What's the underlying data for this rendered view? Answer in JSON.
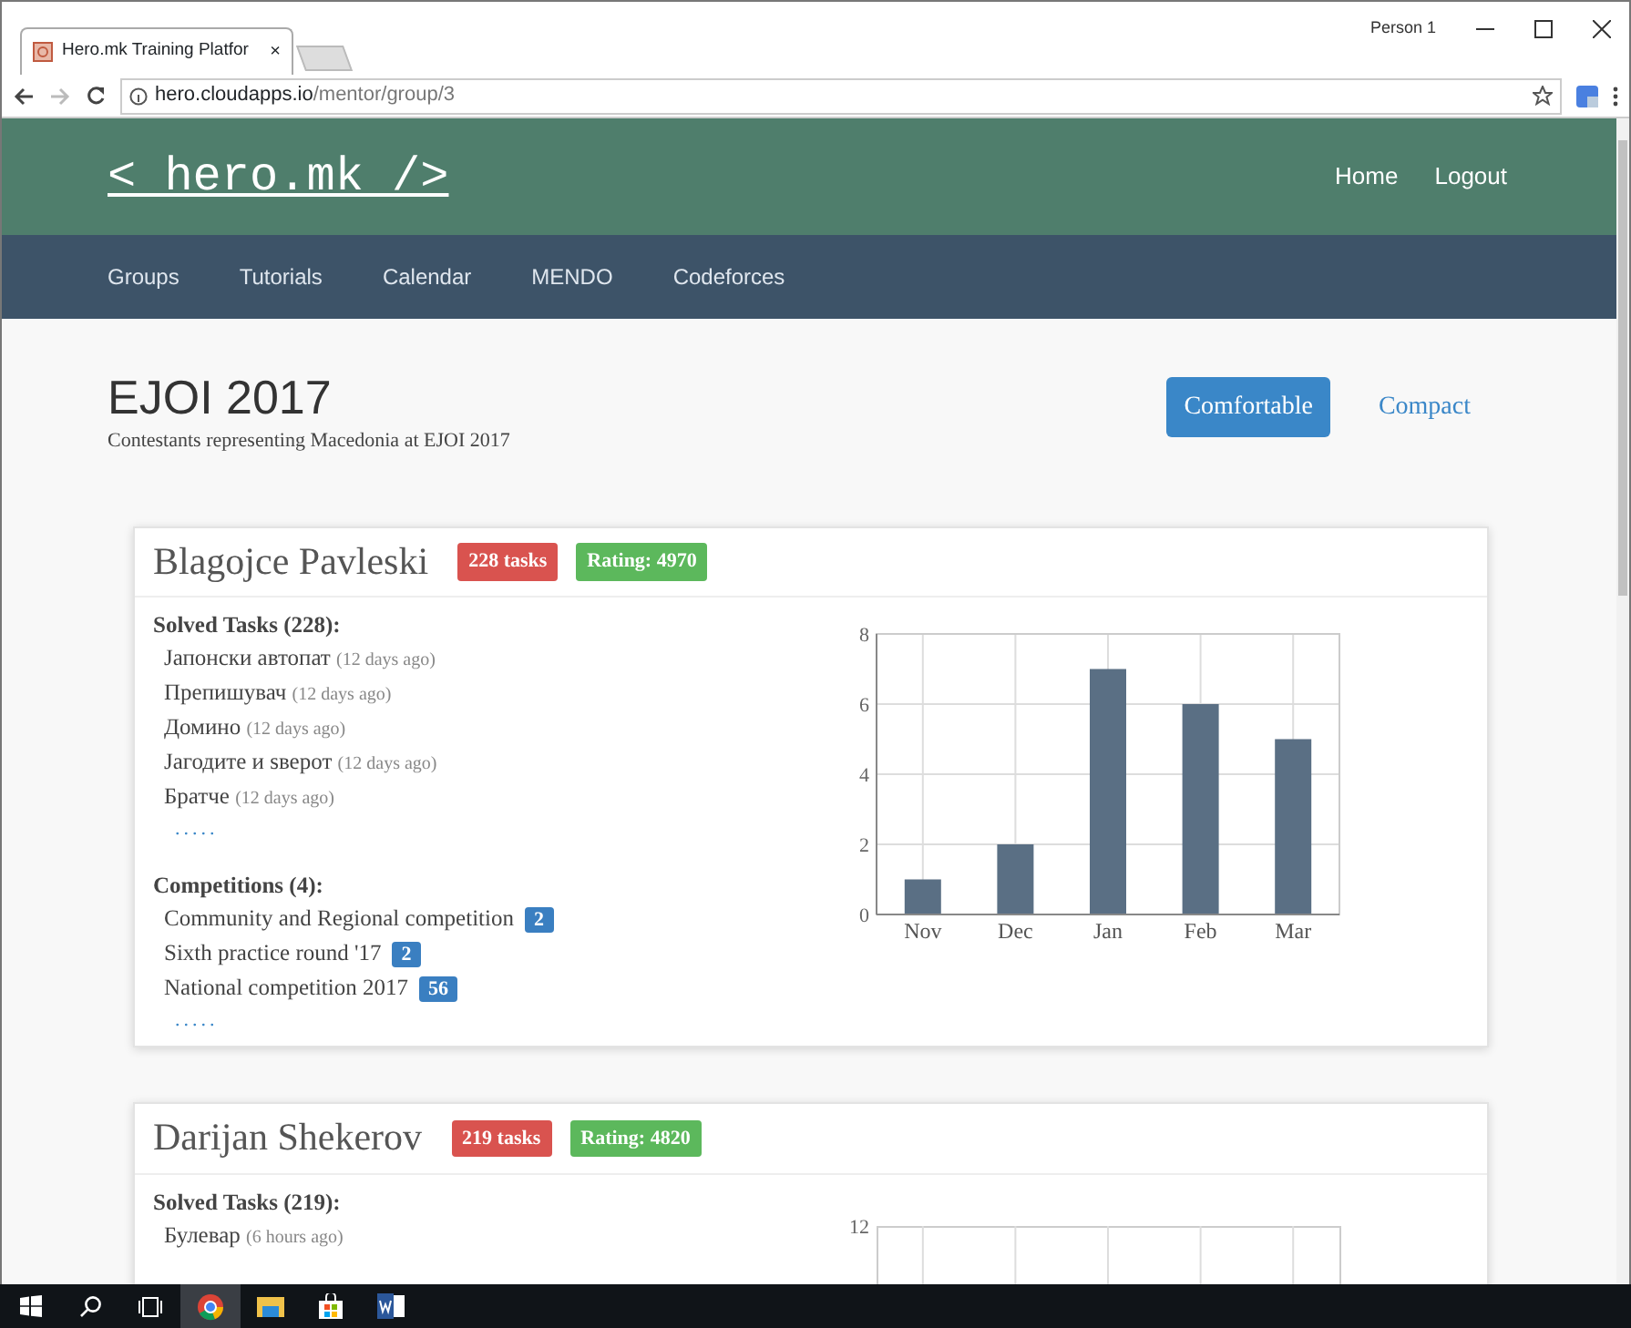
{
  "browser": {
    "tab_title": "Hero.mk Training Platfor",
    "tab_close": "×",
    "user": "Person 1",
    "url_host": "hero.cloudapps.io",
    "url_path": "/mentor/group/3"
  },
  "header": {
    "logo": "< hero.mk />",
    "links": [
      "Home",
      "Logout"
    ]
  },
  "nav": [
    "Groups",
    "Tutorials",
    "Calendar",
    "MENDO",
    "Codeforces"
  ],
  "page": {
    "title": "EJOI 2017",
    "subtitle": "Contestants representing Macedonia at EJOI 2017",
    "view_modes": [
      {
        "label": "Comfortable",
        "selected": true
      },
      {
        "label": "Compact",
        "selected": false
      }
    ]
  },
  "contestants": [
    {
      "name": "Blagojce Pavleski",
      "tasks_badge": "228 tasks",
      "rating_badge": "Rating: 4970",
      "solved_heading": "Solved Tasks (228):",
      "solved": [
        {
          "task": "Јапонски автопат",
          "when": "(12 days ago)"
        },
        {
          "task": "Препишувач",
          "when": "(12 days ago)"
        },
        {
          "task": "Домино",
          "when": "(12 days ago)"
        },
        {
          "task": "Јагодите и ѕверот",
          "when": "(12 days ago)"
        },
        {
          "task": "Братче",
          "when": "(12 days ago)"
        }
      ],
      "solved_more": ".....",
      "competitions_heading": "Competitions (4):",
      "competitions": [
        {
          "name": "Community and Regional competition",
          "count": "2"
        },
        {
          "name": "Sixth practice round '17",
          "count": "2"
        },
        {
          "name": "National competition 2017",
          "count": "56"
        }
      ],
      "competitions_more": ".....",
      "chart_data": {
        "type": "bar",
        "grid": true,
        "categories": [
          "Nov",
          "Dec",
          "Jan",
          "Feb",
          "Mar"
        ],
        "series": [
          {
            "color": "#5a6f84",
            "values": [
              1,
              2,
              7,
              6,
              5
            ]
          }
        ],
        "ylim": [
          0,
          8
        ],
        "yticks": [
          0,
          2,
          4,
          6,
          8
        ]
      }
    },
    {
      "name": "Darijan Shekerov",
      "tasks_badge": "219 tasks",
      "rating_badge": "Rating: 4820",
      "solved_heading": "Solved Tasks (219):",
      "solved": [
        {
          "task": "Булевар",
          "when": "(6 hours ago)"
        }
      ],
      "chart_top_tick": "12"
    }
  ]
}
